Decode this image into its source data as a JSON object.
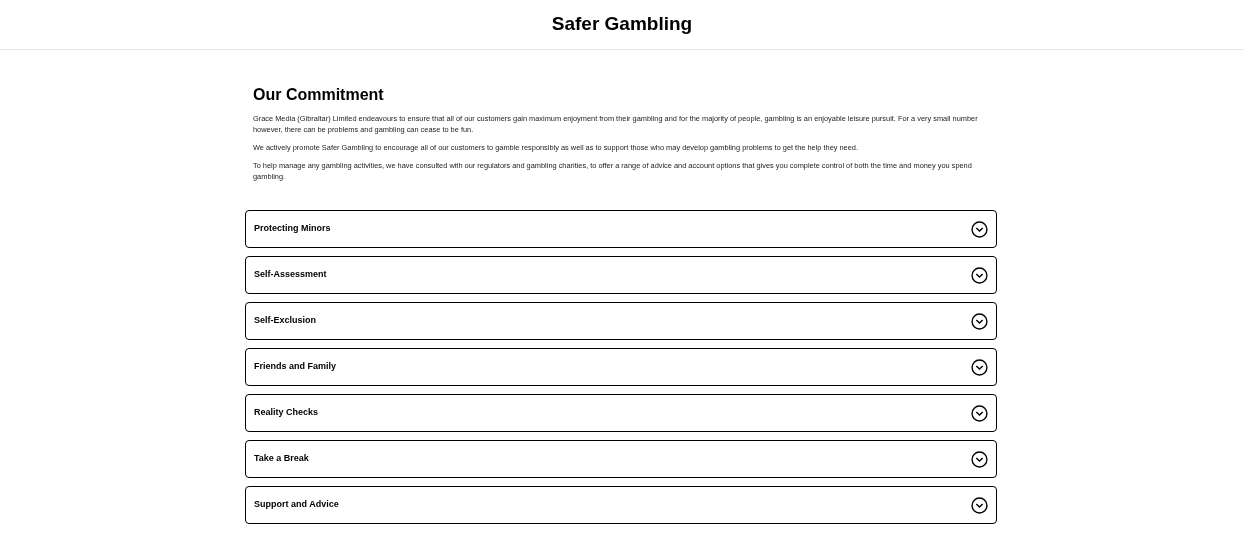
{
  "header": {
    "title": "Safer Gambling"
  },
  "commitment": {
    "heading": "Our Commitment",
    "paragraphs": [
      "Grace Media (Gibraltar) Limited endeavours to ensure that all of our customers gain maximum enjoyment from their gambling and for the majority of people, gambling is an enjoyable leisure pursuit. For a very small number however, there can be problems and gambling can cease to be fun.",
      "We actively promote Safer Gambling to encourage all of our customers to gamble responsibly as well as to support those who may develop gambling problems to get the help they need.",
      "To help manage any gambling activities, we have consulted with our regulators and gambling charities, to offer a range of advice and account options that gives you complete control of both the time and money you spend gambling."
    ]
  },
  "accordion": [
    {
      "label": "Protecting Minors",
      "expanded": false
    },
    {
      "label": "Self-Assessment",
      "expanded": false
    },
    {
      "label": "Self-Exclusion",
      "expanded": false
    },
    {
      "label": "Friends and Family",
      "expanded": false
    },
    {
      "label": "Reality Checks",
      "expanded": false
    },
    {
      "label": "Take a Break",
      "expanded": false
    },
    {
      "label": "Support and Advice",
      "expanded": false
    }
  ]
}
